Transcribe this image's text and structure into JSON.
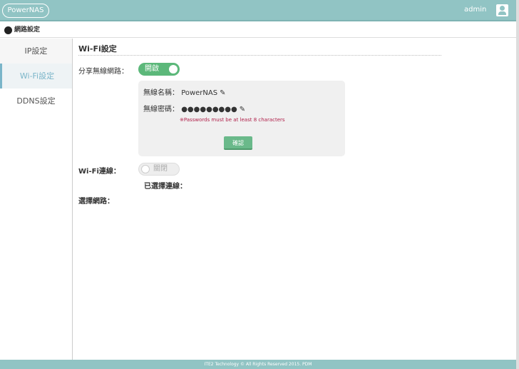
{
  "header": {
    "logo": "PowerNAS",
    "user": "admin"
  },
  "breadcrumb": "網路設定",
  "sidebar": {
    "items": [
      {
        "label": "IP設定"
      },
      {
        "label": "Wi-Fi設定"
      },
      {
        "label": "DDNS設定"
      }
    ]
  },
  "main": {
    "title": "Wi-Fi設定",
    "share_label": "分享無線網路：",
    "share_toggle": "開啟",
    "ssid_label": "無線名稱：",
    "ssid_value": "PowerNAS",
    "pw_label": "無線密碼：",
    "pw_value": "●●●●●●●●●",
    "pw_warning": "※Passwords must be at least 8 characters",
    "confirm": "確認",
    "wifi_conn_label": "Wi-Fi連線：",
    "wifi_toggle": "關閉",
    "selected_label": "已選擇連線：",
    "select_net_label": "選擇網路："
  },
  "footer": "ITE2 Technology © All Rights Reserved 2015. PDM"
}
